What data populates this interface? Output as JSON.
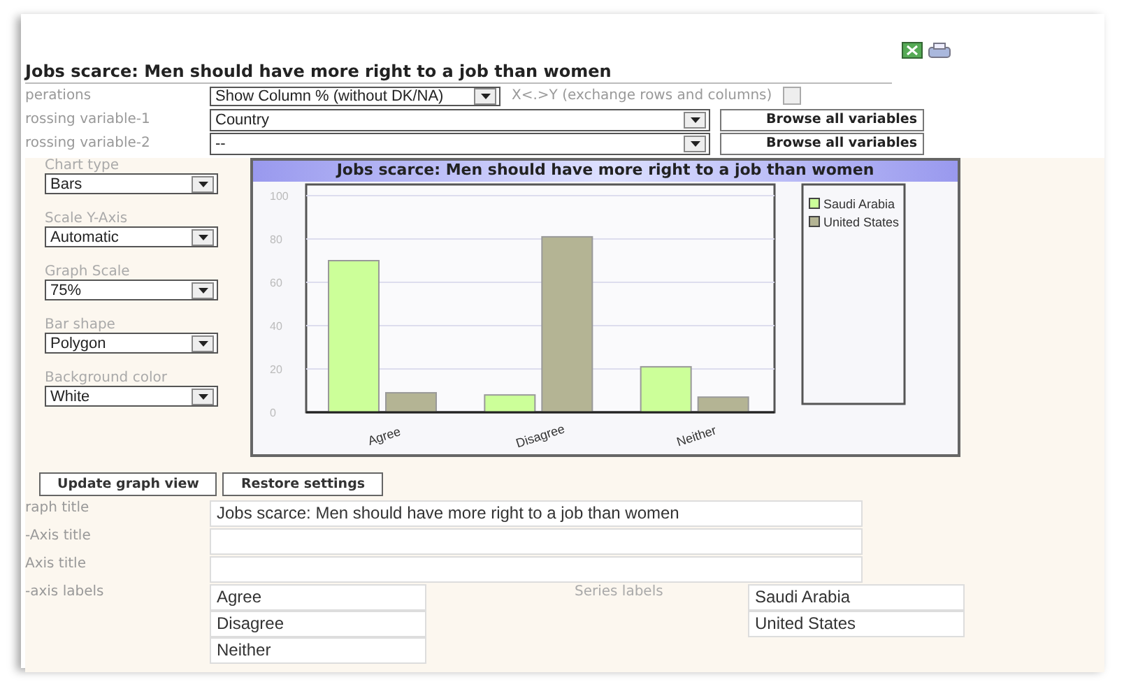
{
  "title": "Jobs scarce: Men should have more right to a job than women",
  "operations": {
    "label": "perations",
    "value": "Show Column % (without DK/NA)"
  },
  "exchange": {
    "label": "X<.>Y (exchange rows and columns)",
    "checked": false
  },
  "crossing": [
    {
      "label": "rossing variable-1",
      "value": "Country",
      "button": "Browse all variables"
    },
    {
      "label": "rossing variable-2",
      "value": "--",
      "button": "Browse all variables"
    }
  ],
  "options": [
    {
      "label": "Chart type",
      "value": "Bars"
    },
    {
      "label": "Scale Y-Axis",
      "value": "Automatic"
    },
    {
      "label": "Graph Scale",
      "value": "75%"
    },
    {
      "label": "Bar shape",
      "value": "Polygon"
    },
    {
      "label": "Background color",
      "value": "White"
    }
  ],
  "chart": {
    "chart_data": {
      "type": "bar",
      "title": "Jobs scarce: Men should have more right to a job than women",
      "categories": [
        "Agree",
        "Disagree",
        "Neither"
      ],
      "series": [
        {
          "name": "Saudi Arabia",
          "color": "#ccff99",
          "values": [
            70,
            8,
            21
          ]
        },
        {
          "name": "United States",
          "color": "#b4b494",
          "values": [
            9,
            81,
            7
          ]
        }
      ],
      "ylim": [
        0,
        100
      ],
      "grid": true,
      "legend": "right",
      "yticks": [
        0,
        20,
        40,
        60,
        {
          "value": 80,
          "label": "80"
        },
        100
      ]
    }
  },
  "buttons": [
    "Update graph view",
    "Restore settings"
  ],
  "text_fields": [
    {
      "label": "raph title",
      "value": "Jobs scarce: Men should have more right to a job than women"
    },
    {
      "label": "-Axis title"
    },
    {
      "label": "Axis title"
    }
  ],
  "x_axis_labels": {
    "label": "-axis labels",
    "values": [
      "Agree",
      "Disagree",
      "Neither"
    ]
  },
  "series_labels": {
    "label": "Series labels",
    "values": [
      "Saudi Arabia",
      "United States"
    ]
  }
}
